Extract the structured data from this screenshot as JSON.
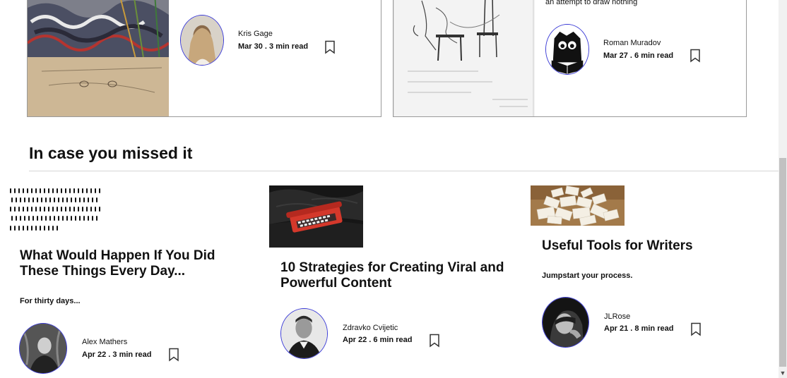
{
  "top_cards": [
    {
      "author": "Kris Gage",
      "meta": "Mar 30 . 3 min read"
    },
    {
      "title": "an attempt to draw nothing",
      "author": "Roman Muradov",
      "meta": "Mar 27 . 6 min read"
    }
  ],
  "section": {
    "title": "In case you missed it"
  },
  "articles": [
    {
      "title": "What Would Happen If You Did These Things Every Day...",
      "subtitle": "For thirty days...",
      "author": "Alex Mathers",
      "meta": "Apr 22 . 3 min read"
    },
    {
      "title": "10 Strategies for Creating Viral and Powerful Content",
      "subtitle": "",
      "author": "Zdravko Cvijetic",
      "meta": "Apr 22 . 6 min read"
    },
    {
      "title": "Useful Tools for Writers",
      "subtitle": "Jumpstart your process.",
      "author": "JLRose",
      "meta": "Apr 21 . 8 min read"
    }
  ],
  "colors": {
    "avatar_border": "#3b3bd8",
    "text": "#111111",
    "card_border": "#9a9a9a"
  }
}
